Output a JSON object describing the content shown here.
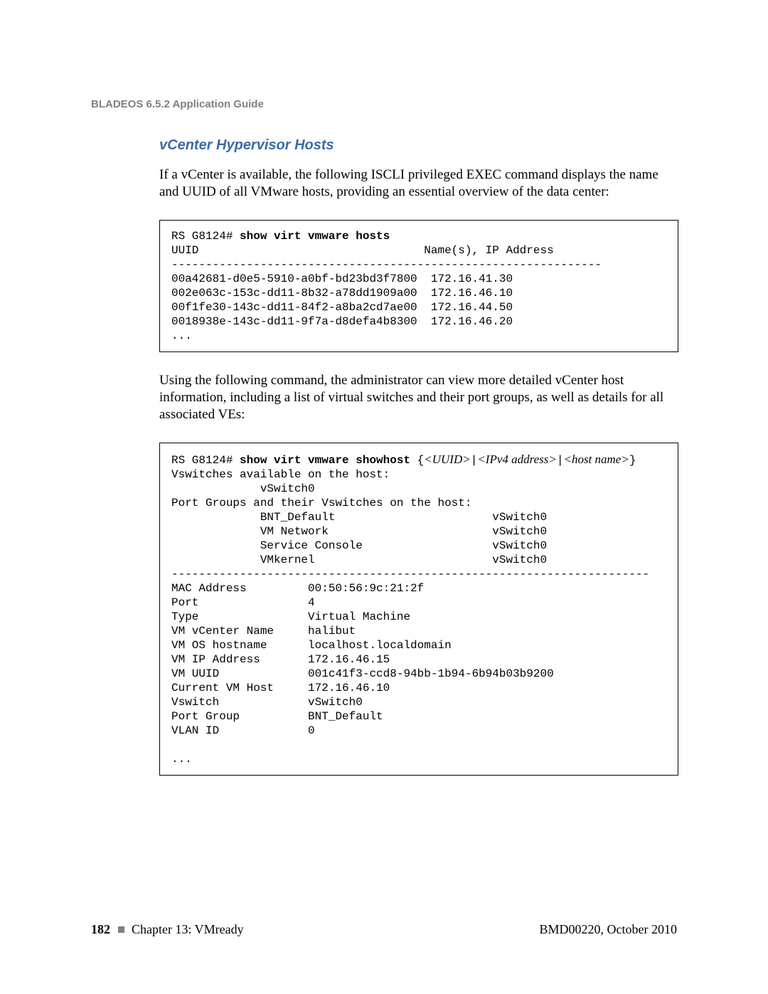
{
  "header": {
    "running_head": "BLADEOS 6.5.2 Application Guide"
  },
  "section": {
    "title": "vCenter Hypervisor Hosts",
    "para1": "If a vCenter is available, the following ISCLI privileged EXEC command displays the name and UUID of all VMware hosts, providing an essential overview of the data center:",
    "para2": "Using the following command, the administrator can view more detailed vCenter host information, including a list of virtual switches and their port groups, as well as details for all associated VEs:"
  },
  "code1": {
    "prompt": "RS G8124# ",
    "cmd": "show virt vmware hosts",
    "header_row": "UUID                                 Name(s), IP Address",
    "divider": "---------------------------------------------------------------",
    "rows": [
      "00a42681-d0e5-5910-a0bf-bd23bd3f7800  172.16.41.30",
      "002e063c-153c-dd11-8b32-a78dd1909a00  172.16.46.10",
      "00f1fe30-143c-dd11-84f2-a8ba2cd7ae00  172.16.44.50",
      "0018938e-143c-dd11-9f7a-d8defa4b8300  172.16.46.20"
    ],
    "trailer": "..."
  },
  "code2": {
    "prompt": "RS G8124# ",
    "cmd": "show virt vmware showhost",
    "args_open": " {",
    "arg1": "<UUID>",
    "sep": "|",
    "arg2": "<IPv4 address>",
    "arg3": "<host name>",
    "args_close": "}",
    "lines": [
      "Vswitches available on the host:",
      "             vSwitch0",
      "Port Groups and their Vswitches on the host:",
      "             BNT_Default                       vSwitch0",
      "             VM Network                        vSwitch0",
      "             Service Console                   vSwitch0",
      "             VMkernel                          vSwitch0",
      "----------------------------------------------------------------------",
      "MAC Address         00:50:56:9c:21:2f",
      "Port                4",
      "Type                Virtual Machine",
      "VM vCenter Name     halibut",
      "VM OS hostname      localhost.localdomain",
      "VM IP Address       172.16.46.15",
      "VM UUID             001c41f3-ccd8-94bb-1b94-6b94b03b9200",
      "Current VM Host     172.16.46.10",
      "Vswitch             vSwitch0",
      "Port Group          BNT_Default",
      "VLAN ID             0",
      "",
      "..."
    ]
  },
  "footer": {
    "page_number": "182",
    "chapter": "Chapter 13: VMready",
    "doc_id": "BMD00220, October 2010"
  }
}
